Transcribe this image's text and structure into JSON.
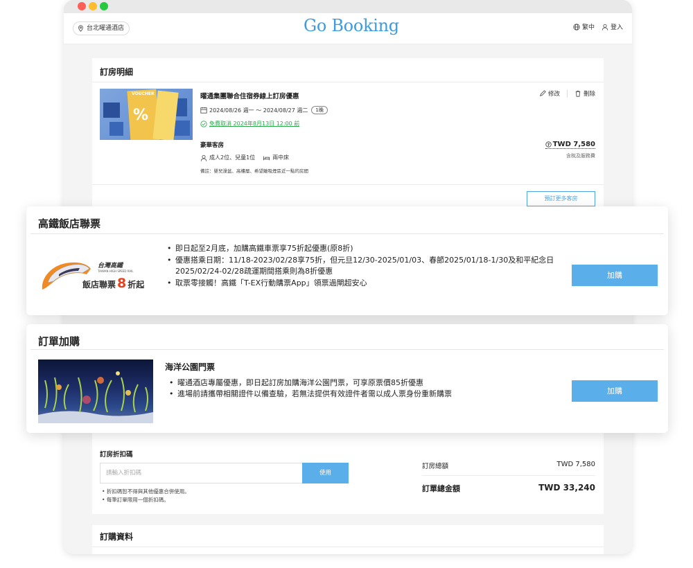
{
  "header": {
    "hotel_name": "台北曜通酒店",
    "logo": "Go Booking",
    "language": "繁中",
    "login": "登入"
  },
  "booking_detail": {
    "section_title": "訂房明細",
    "plan_name": "曜通集團聯合住宿券線上訂房優惠",
    "dates": "2024/08/26 週一 ～ 2024/08/27 週二",
    "nights": "1晚",
    "free_cancel": "免費取消 2024年8月13日 12:00 前",
    "edit_label": "修改",
    "delete_label": "刪除",
    "room_type": "豪華客房",
    "guests": "成人2位、兒童1位",
    "bed": "兩中床",
    "note": "備註：嬰兒澡盆、高樓層、希望離吸煙區近一點的房間",
    "price": "TWD 7,580",
    "price_note": "含稅及服務費",
    "more_rooms_button": "預訂更多客房",
    "image_text": {
      "voucher": "VOUCHER",
      "percent": "%"
    }
  },
  "hsr_modal": {
    "title": "高鐵飯店聯票",
    "logo_text_1": "台灣高鐵",
    "logo_text_2": "TAIWAN HIGH SPEED RAIL",
    "logo_text_3": "飯店聯票",
    "logo_text_4": "8",
    "logo_text_5": "折起",
    "bullets": [
      "即日起至2月底，加購高鐵車票享75折起優惠(原8折)",
      "優惠搭乘日期：11/18-2023/02/28享75折，但元旦12/30-2025/01/03、春節2025/01/18-1/30及和平紀念日",
      "取票零接觸！高鐵「T-EX行動購票App」領票過閘超安心"
    ],
    "bullet_2_cont": "2025/02/24-02/28疏運期間搭乘則為8折優惠",
    "add_button": "加購"
  },
  "order_addon_modal": {
    "title": "訂單加購",
    "product_name": "海洋公園門票",
    "bullets": [
      "曜通酒店專屬優惠，即日起訂房加購海洋公園門票，可享原票價85折優惠",
      "進場前請攜帶相關證件以備查驗，若無法提供有效證件者需以成人票身份重新購票"
    ],
    "add_button": "加購"
  },
  "summary": {
    "coupon_title": "訂房折扣碼",
    "coupon_placeholder": "請輸入折扣碼",
    "apply_button": "使用",
    "coupon_notes": [
      "折扣碼恕不得與其他優惠合併使用。",
      "每筆訂單限用一個折扣碼。"
    ],
    "room_total_label": "訂房總額",
    "room_total_value": "TWD 7,580",
    "order_total_label": "訂單總金額",
    "order_total_value": "TWD 33,240"
  },
  "purchase_info": {
    "section_title": "訂購資料"
  },
  "colors": {
    "brand_blue": "#3d9be0",
    "button_blue": "#5aaeea",
    "free_cancel_green": "#2aa84a"
  }
}
